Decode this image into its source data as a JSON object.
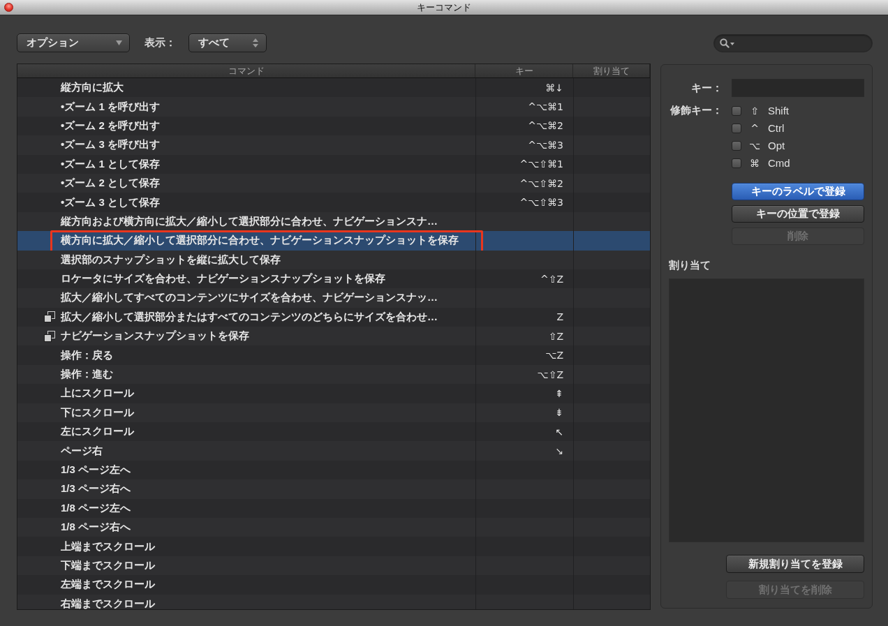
{
  "window": {
    "title": "キーコマンド"
  },
  "toolbar": {
    "options_menu": {
      "label": "オプション"
    },
    "view_label": "表示：",
    "view_menu": {
      "value": "すべて"
    }
  },
  "table": {
    "columns": [
      "コマンド",
      "キー",
      "割り当て"
    ],
    "rows": [
      {
        "kind": "plain",
        "command": "縦方向に拡大",
        "key": "⌘↓",
        "selected": false,
        "framed": false
      },
      {
        "kind": "plain",
        "command": "•ズーム 1 を呼び出す",
        "key": "^⌥⌘1",
        "selected": false,
        "framed": false
      },
      {
        "kind": "plain",
        "command": "•ズーム 2 を呼び出す",
        "key": "^⌥⌘2",
        "selected": false,
        "framed": false
      },
      {
        "kind": "plain",
        "command": "•ズーム 3 を呼び出す",
        "key": "^⌥⌘3",
        "selected": false,
        "framed": false
      },
      {
        "kind": "plain",
        "command": "•ズーム 1 として保存",
        "key": "^⌥⇧⌘1",
        "selected": false,
        "framed": false
      },
      {
        "kind": "plain",
        "command": "•ズーム 2 として保存",
        "key": "^⌥⇧⌘2",
        "selected": false,
        "framed": false
      },
      {
        "kind": "plain",
        "command": "•ズーム 3 として保存",
        "key": "^⌥⇧⌘3",
        "selected": false,
        "framed": false
      },
      {
        "kind": "plain",
        "command": "縦方向および横方向に拡大／縮小して選択部分に合わせ、ナビゲーションスナ…",
        "selected": false,
        "framed": false
      },
      {
        "kind": "plain",
        "command": "横方向に拡大／縮小して選択部分に合わせ、ナビゲーションスナップショットを保存",
        "selected": true,
        "framed": true
      },
      {
        "kind": "plain",
        "command": "選択部のスナップショットを縦に拡大して保存",
        "selected": false,
        "framed": false
      },
      {
        "kind": "plain",
        "command": "ロケータにサイズを合わせ、ナビゲーションスナップショットを保存",
        "key": "^⇧Z",
        "selected": false,
        "framed": false
      },
      {
        "kind": "plain",
        "command": "拡大／縮小してすべてのコンテンツにサイズを合わせ、ナビゲーションスナッ…",
        "selected": false,
        "framed": false
      },
      {
        "kind": "stacked",
        "command": "拡大／縮小して選択部分またはすべてのコンテンツのどちらにサイズを合わせ…",
        "key": "Z",
        "selected": false,
        "framed": false
      },
      {
        "kind": "stacked",
        "command": "ナビゲーションスナップショットを保存",
        "key": "⇧Z",
        "selected": false,
        "framed": false
      },
      {
        "kind": "plain",
        "command": "操作：戻る",
        "key": "⌥Z",
        "selected": false,
        "framed": false
      },
      {
        "kind": "plain",
        "command": "操作：進む",
        "key": "⌥⇧Z",
        "selected": false,
        "framed": false
      },
      {
        "kind": "plain",
        "command": "上にスクロール",
        "key": "⇞",
        "selected": false,
        "framed": false
      },
      {
        "kind": "plain",
        "command": "下にスクロール",
        "key": "⇟",
        "selected": false,
        "framed": false
      },
      {
        "kind": "plain",
        "command": "左にスクロール",
        "key": "↖",
        "selected": false,
        "framed": false
      },
      {
        "kind": "plain",
        "command": "ページ右",
        "key": "↘",
        "selected": false,
        "framed": false
      },
      {
        "kind": "plain",
        "command": "1/3 ページ左へ",
        "selected": false,
        "framed": false
      },
      {
        "kind": "plain",
        "command": "1/3 ページ右へ",
        "selected": false,
        "framed": false
      },
      {
        "kind": "plain",
        "command": "1/8 ページ左へ",
        "selected": false,
        "framed": false
      },
      {
        "kind": "plain",
        "command": "1/8 ページ右へ",
        "selected": false,
        "framed": false
      },
      {
        "kind": "plain",
        "command": "上端までスクロール",
        "selected": false,
        "framed": false
      },
      {
        "kind": "plain",
        "command": "下端までスクロール",
        "selected": false,
        "framed": false
      },
      {
        "kind": "plain",
        "command": "左端までスクロール",
        "selected": false,
        "framed": false
      },
      {
        "kind": "plain",
        "command": "右端までスクロール",
        "selected": false,
        "framed": false
      }
    ]
  },
  "inspector": {
    "key_label": "キー：",
    "modifier_label": "修飾キー：",
    "modifiers": [
      {
        "symbol": "⇧",
        "label": "Shift",
        "checked": false
      },
      {
        "symbol": "^",
        "label": "Ctrl",
        "checked": false
      },
      {
        "symbol": "⌥",
        "label": "Opt",
        "checked": false
      },
      {
        "symbol": "⌘",
        "label": "Cmd",
        "checked": false
      }
    ],
    "buttons": [
      {
        "label": "キーのラベルで登録",
        "default": true,
        "disabled": false
      },
      {
        "label": "キーの位置で登録",
        "default": false,
        "disabled": false
      },
      {
        "label": "削除",
        "default": false,
        "disabled": true
      }
    ],
    "assignments_label": "割り当て",
    "assignment_buttons": [
      {
        "label": "新規割り当てを登録",
        "default": false,
        "disabled": false
      },
      {
        "label": "割り当てを削除",
        "default": false,
        "disabled": true
      }
    ]
  }
}
